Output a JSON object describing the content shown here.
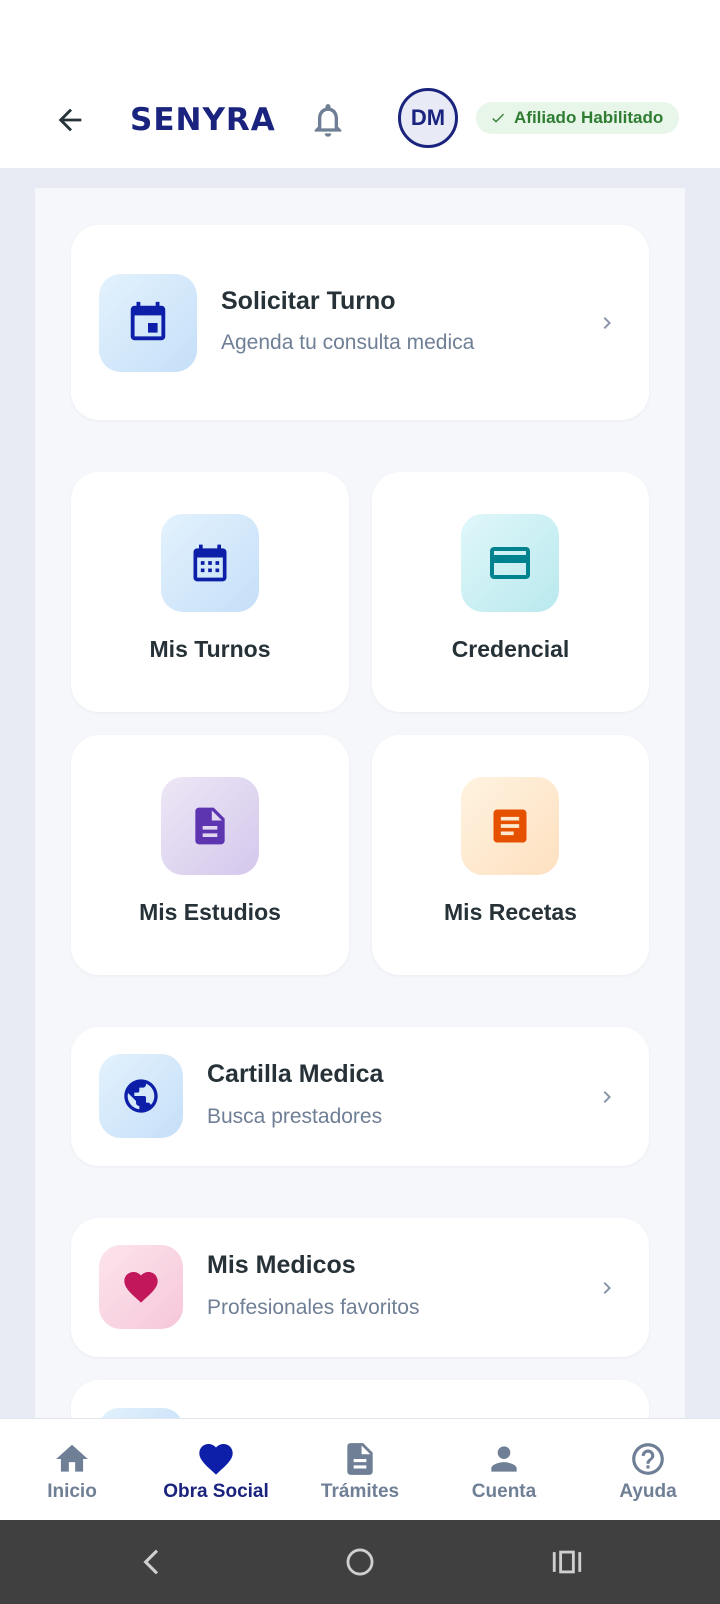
{
  "header": {
    "brand": "SENYRA",
    "avatar_initials": "DM",
    "status_badge": "Afiliado Habilitado"
  },
  "main": {
    "primary_card": {
      "title": "Solicitar Turno",
      "subtitle": "Agenda tu consulta medica",
      "icon": "calendar-event-icon"
    },
    "tiles": [
      {
        "label": "Mis Turnos",
        "icon": "calendar-grid-icon"
      },
      {
        "label": "Credencial",
        "icon": "credit-card-icon"
      },
      {
        "label": "Mis Estudios",
        "icon": "document-icon"
      },
      {
        "label": "Mis Recetas",
        "icon": "prescription-list-icon"
      }
    ],
    "list": [
      {
        "title": "Cartilla Medica",
        "subtitle": "Busca prestadores",
        "icon": "globe-icon"
      },
      {
        "title": "Mis Medicos",
        "subtitle": "Profesionales favoritos",
        "icon": "heart-icon"
      }
    ]
  },
  "bottom_nav": {
    "items": [
      {
        "label": "Inicio",
        "icon": "home-icon"
      },
      {
        "label": "Obra Social",
        "icon": "heart-icon",
        "active": true
      },
      {
        "label": "Trámites",
        "icon": "document-icon"
      },
      {
        "label": "Cuenta",
        "icon": "person-icon"
      },
      {
        "label": "Ayuda",
        "icon": "help-circle-icon"
      }
    ]
  },
  "colors": {
    "brand": "#1a237e",
    "badge_bg": "#e8f5e9",
    "badge_text": "#2e7d32",
    "teal": "#00838f",
    "purple": "#5e35b1",
    "orange": "#e65100",
    "pink": "#c2185b"
  }
}
